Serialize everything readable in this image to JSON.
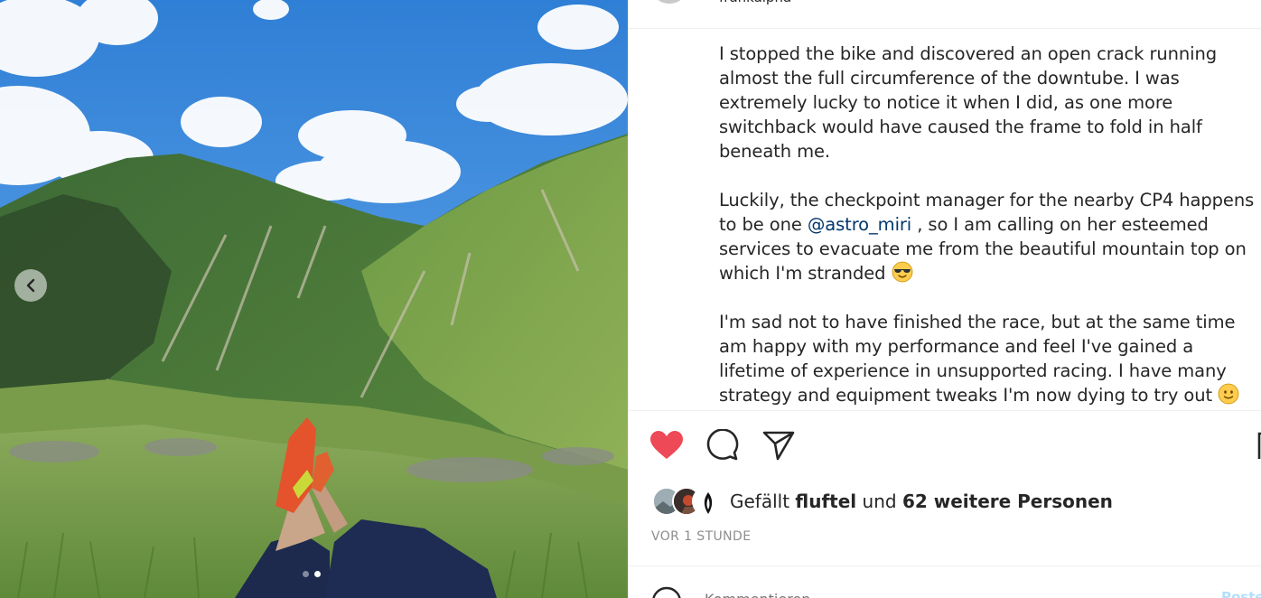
{
  "post": {
    "header": {
      "username": "frankalpha"
    },
    "caption": {
      "p1": "I stopped the bike and discovered an open crack running almost the full circumference of the downtube. I was extremely lucky to notice it when I did, as one more switchback would have caused the frame to fold in half beneath me.",
      "p2_before": "Luckily, the checkpoint manager for the nearby CP4 happens to be one ",
      "p2_mention": "@astro_miri",
      "p2_after": " , so I am calling on her esteemed services to evacuate me from the beautiful mountain top on which I'm stranded ",
      "p3": "I'm sad not to have finished the race, but at the same time am happy with my performance and feel I've gained a lifetime of experience in unsupported racing. I have many strategy and equipment tweaks I'm now dying to try out "
    },
    "likes": {
      "prefix": "Gefällt ",
      "user": "fluftel",
      "middle": " und ",
      "others": "62 weitere Personen"
    },
    "timestamp": "VOR 1 STUNDE",
    "comment": {
      "placeholder": "Kommentieren ...",
      "post_label": "Posten"
    },
    "carousel": {
      "slide_count": 2,
      "active_index": 1
    },
    "icons": {
      "like": "heart-icon",
      "comment": "speech-bubble-icon",
      "share": "paper-plane-icon",
      "save": "bookmark-icon",
      "prev": "chevron-left-icon",
      "emoji_1": "sunglasses-face-emoji",
      "emoji_2": "slightly-smiling-face-emoji"
    },
    "colors": {
      "like_red": "#ed4956",
      "mention_blue": "#00376b",
      "muted_gray": "#8e8e8e",
      "text": "#262626"
    }
  }
}
